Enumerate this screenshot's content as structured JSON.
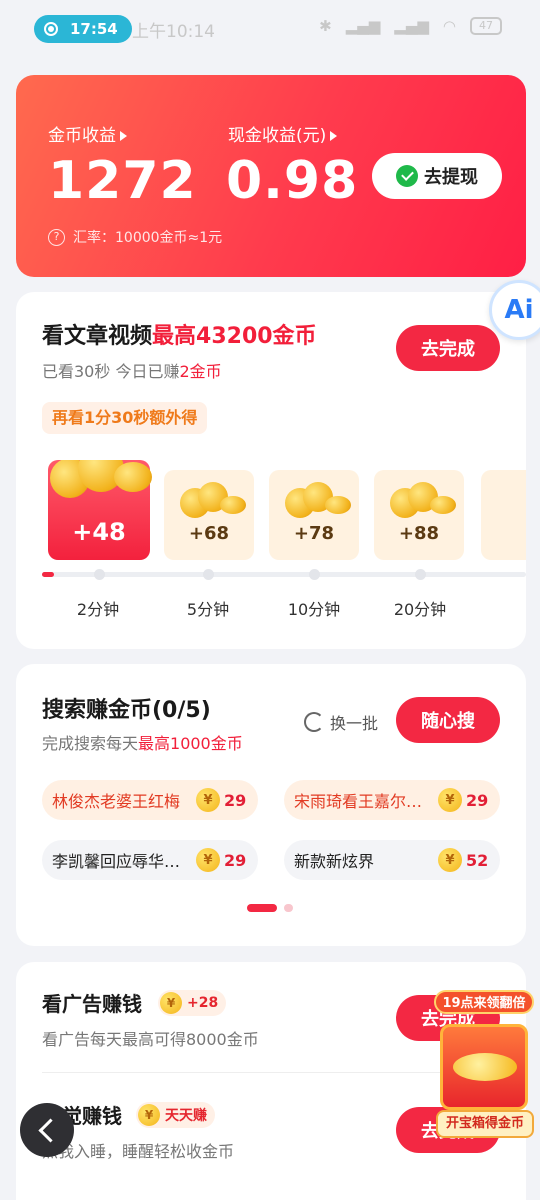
{
  "status_bar": {
    "time": "17:54",
    "clock_text": "上午10:14",
    "battery": "47"
  },
  "earnings": {
    "coin_label": "金币收益",
    "coin_value": "1272",
    "cash_label": "现金收益(元)",
    "cash_value": "0.98",
    "withdraw_label": "去提现",
    "rate_text": "汇率：10000金币≈1元"
  },
  "ai_badge": "Ai",
  "article_task": {
    "title": "看文章视频",
    "title_highlight": "最高43200金币",
    "sub": "已看30秒 今日已赚",
    "sub_highlight": "2金币",
    "button": "去完成",
    "extra_tag": "再看1分30秒额外得",
    "rewards": [
      "+48",
      "+68",
      "+78",
      "+88"
    ],
    "minutes": [
      "2分钟",
      "5分钟",
      "10分钟",
      "20分钟"
    ]
  },
  "search_task": {
    "title": "搜索赚金币(0/5)",
    "sub": "完成搜索每天",
    "sub_highlight": "最高1000金币",
    "refresh_label": "换一批",
    "button": "随心搜",
    "keywords": [
      {
        "text": "林俊杰老婆王红梅",
        "coins": "29",
        "style": "hot"
      },
      {
        "text": "宋雨琦看王嘉尔…",
        "coins": "29",
        "style": "hot"
      },
      {
        "text": "李凯馨回应辱华…",
        "coins": "29",
        "style": "norm"
      },
      {
        "text": "新款新炫界",
        "coins": "52",
        "style": "norm"
      }
    ]
  },
  "ad_task": {
    "title": "看广告赚钱",
    "badge": "+28",
    "sub": "看广告每天最高可得8000金币",
    "button": "去完成"
  },
  "sleep_task": {
    "title": "睡觉赚钱",
    "badge": "天天赚",
    "sub": "点我入睡，睡醒轻松收金币",
    "button": "去完成"
  },
  "treasure": {
    "top_tag": "19点来领翻倍",
    "bottom_tag": "开宝箱得金币"
  }
}
